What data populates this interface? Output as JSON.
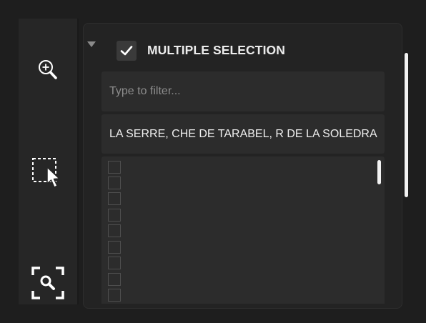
{
  "toolbar": {
    "tools": [
      {
        "name": "zoom-in",
        "icon": "zoom-in-icon"
      },
      {
        "name": "rectangle-select",
        "icon": "rectangle-select-cursor-icon"
      },
      {
        "name": "zoom-to-extent",
        "icon": "zoom-extent-icon"
      }
    ]
  },
  "filter": {
    "multiple_selection_checked": true,
    "multiple_selection_label": "MULTIPLE SELECTION",
    "filter_placeholder": "Type to filter...",
    "selected_values": "LA SERRE, CHE DE TARABEL, R DE LA SOLEDRA",
    "option_count_visible": 9
  },
  "colors": {
    "background": "#1e1e1e",
    "panel": "#232323",
    "field": "#2c2c2c",
    "text": "#ececec",
    "placeholder": "#8d8d8d",
    "scrollbar": "#f2f2f2"
  }
}
